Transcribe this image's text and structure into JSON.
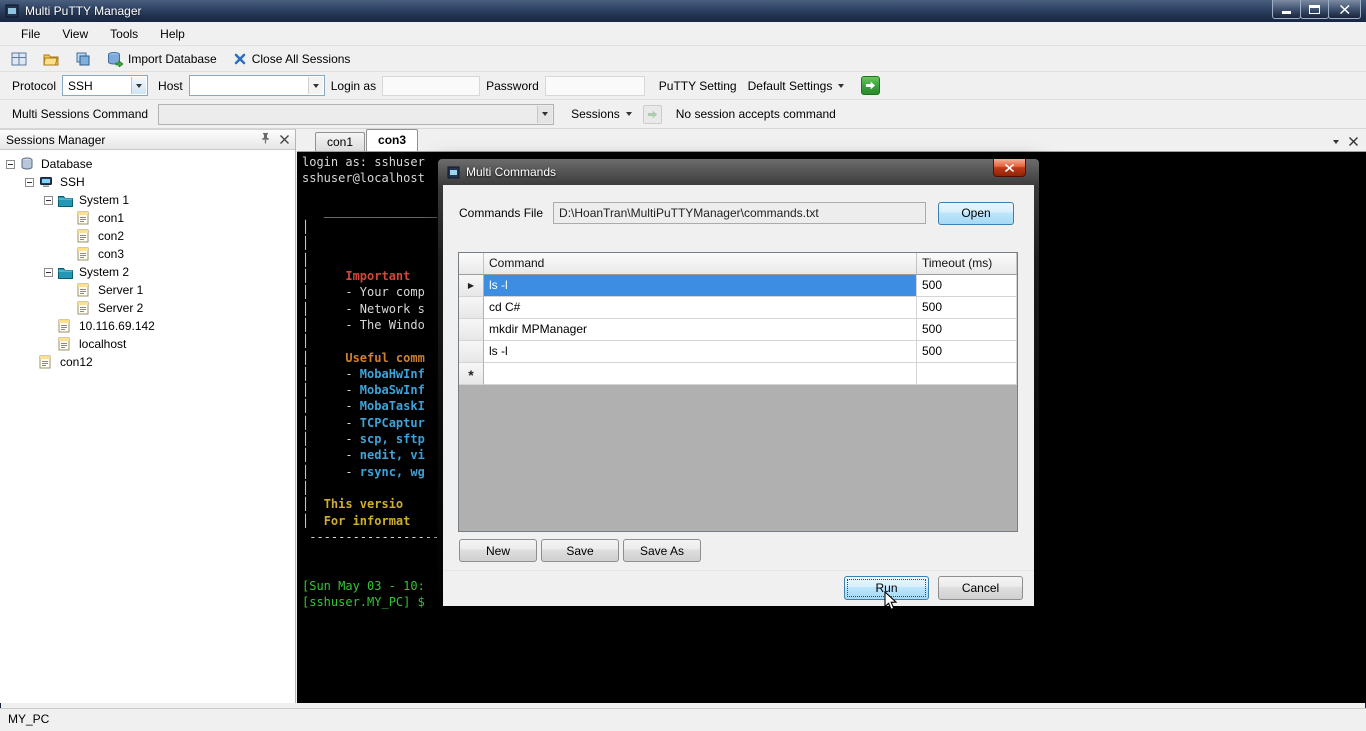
{
  "window": {
    "title": "Multi PuTTY Manager",
    "status_bar": "MY_PC"
  },
  "menu": {
    "items": [
      "File",
      "View",
      "Tools",
      "Help"
    ]
  },
  "toolbar": {
    "import_database": "Import Database",
    "close_all_sessions": "Close All Sessions"
  },
  "connection_bar": {
    "protocol_label": "Protocol",
    "protocol_value": "SSH",
    "host_label": "Host",
    "host_value": "",
    "login_label": "Login as",
    "login_value": "",
    "password_label": "Password",
    "password_value": "",
    "putty_setting_label": "PuTTY Setting",
    "putty_setting_value": "Default Settings"
  },
  "command_bar": {
    "label": "Multi Sessions Command",
    "command_value": "",
    "sessions_label": "Sessions",
    "status_text": "No session accepts command"
  },
  "sessions_panel": {
    "title": "Sessions Manager",
    "tree": [
      {
        "label": "Database",
        "level": 0,
        "icon": "database",
        "expander": true
      },
      {
        "label": "SSH",
        "level": 1,
        "icon": "host",
        "expander": true
      },
      {
        "label": "System 1",
        "level": 2,
        "icon": "folder",
        "expander": true
      },
      {
        "label": "con1",
        "level": 3,
        "icon": "page",
        "expander": false
      },
      {
        "label": "con2",
        "level": 3,
        "icon": "page",
        "expander": false
      },
      {
        "label": "con3",
        "level": 3,
        "icon": "page",
        "expander": false
      },
      {
        "label": "System 2",
        "level": 2,
        "icon": "folder",
        "expander": true
      },
      {
        "label": "Server 1",
        "level": 3,
        "icon": "page",
        "expander": false
      },
      {
        "label": "Server 2",
        "level": 3,
        "icon": "page",
        "expander": false
      },
      {
        "label": "10.116.69.142",
        "level": 2,
        "icon": "page",
        "expander": false
      },
      {
        "label": "localhost",
        "level": 2,
        "icon": "page",
        "expander": false
      },
      {
        "label": "con12",
        "level": 1,
        "icon": "page",
        "expander": false
      }
    ]
  },
  "tabs": [
    {
      "label": "con1",
      "active": false
    },
    {
      "label": "con3",
      "active": true
    }
  ],
  "terminal": {
    "lines": [
      [
        {
          "t": "login as: sshuser",
          "c": "fg"
        }
      ],
      [
        {
          "t": "sshuser@localhost",
          "c": "fg"
        }
      ],
      [],
      [
        {
          "t": "   _________________",
          "c": "fg"
        }
      ],
      [
        {
          "t": "│",
          "c": "fg"
        }
      ],
      [
        {
          "t": "│",
          "c": "fg"
        }
      ],
      [
        {
          "t": "│",
          "c": "fg"
        }
      ],
      [
        {
          "t": "│     ",
          "c": "fg"
        },
        {
          "t": "Important",
          "c": "red"
        }
      ],
      [
        {
          "t": "│     - Your comp",
          "c": "fg"
        }
      ],
      [
        {
          "t": "│     - Network s",
          "c": "fg"
        }
      ],
      [
        {
          "t": "│     - The Windo",
          "c": "fg"
        }
      ],
      [
        {
          "t": "│",
          "c": "fg"
        }
      ],
      [
        {
          "t": "│     ",
          "c": "fg"
        },
        {
          "t": "Useful comm",
          "c": "orange"
        }
      ],
      [
        {
          "t": "│     - ",
          "c": "fg"
        },
        {
          "t": "MobaHwInf",
          "c": "cyan"
        }
      ],
      [
        {
          "t": "│     - ",
          "c": "fg"
        },
        {
          "t": "MobaSwInf",
          "c": "cyan"
        }
      ],
      [
        {
          "t": "│     - ",
          "c": "fg"
        },
        {
          "t": "MobaTaskI",
          "c": "cyan"
        }
      ],
      [
        {
          "t": "│     - ",
          "c": "fg"
        },
        {
          "t": "TCPCaptur",
          "c": "cyan"
        }
      ],
      [
        {
          "t": "│     - ",
          "c": "fg"
        },
        {
          "t": "scp, sftp",
          "c": "cyan"
        }
      ],
      [
        {
          "t": "│     - ",
          "c": "fg"
        },
        {
          "t": "nedit, vi",
          "c": "cyan"
        }
      ],
      [
        {
          "t": "│     - ",
          "c": "fg"
        },
        {
          "t": "rsync, wg",
          "c": "cyan"
        }
      ],
      [
        {
          "t": "│",
          "c": "fg"
        }
      ],
      [
        {
          "t": "│  ",
          "c": "fg"
        },
        {
          "t": "This versio",
          "c": "yellow"
        }
      ],
      [
        {
          "t": "│  ",
          "c": "fg"
        },
        {
          "t": "For informat",
          "c": "yellow"
        }
      ],
      [
        {
          "t": " ------------------",
          "c": "fg"
        }
      ],
      [],
      [],
      [
        {
          "t": "[Sun May 03 - 10:",
          "c": "green"
        }
      ],
      [
        {
          "t": "[sshuser.MY_PC] $ ",
          "c": "green"
        }
      ]
    ]
  },
  "dialog": {
    "title": "Multi Commands",
    "commands_file_label": "Commands File",
    "commands_file_value": "D:\\HoanTran\\MultiPuTTYManager\\commands.txt",
    "open_button": "Open",
    "grid": {
      "columns": [
        "Command",
        "Timeout (ms)"
      ],
      "rows": [
        {
          "command": "ls -l",
          "timeout": "500",
          "selected": true,
          "new_row": false
        },
        {
          "command": "cd C#",
          "timeout": "500",
          "selected": false,
          "new_row": false
        },
        {
          "command": "mkdir MPManager",
          "timeout": "500",
          "selected": false,
          "new_row": false
        },
        {
          "command": "ls -l",
          "timeout": "500",
          "selected": false,
          "new_row": false
        },
        {
          "command": "",
          "timeout": "",
          "selected": false,
          "new_row": true
        }
      ]
    },
    "buttons": {
      "new": "New",
      "save": "Save",
      "save_as": "Save As",
      "run": "Run",
      "cancel": "Cancel"
    }
  }
}
